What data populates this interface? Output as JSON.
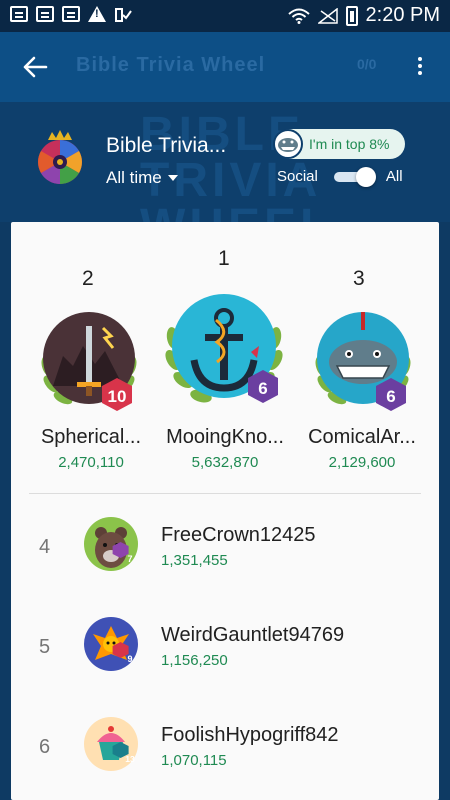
{
  "status_bar": {
    "time": "2:20 PM"
  },
  "app_bar": {
    "title": "Bible Trivia Wheel",
    "faded_label": "0/0"
  },
  "header": {
    "game_title": "Bible Trivia...",
    "watermark": "BIBLE TRIVIA WHEEL",
    "filter_label": "All time",
    "top_badge": "I'm in top 8%",
    "toggle_left": "Social",
    "toggle_right": "All"
  },
  "podium": [
    {
      "rank": "2",
      "name": "Spherical...",
      "score": "2,470,110",
      "level": "10",
      "avatar": "sword-avatar-icon"
    },
    {
      "rank": "1",
      "name": "MooingKno...",
      "score": "5,632,870",
      "level": "6",
      "avatar": "anchor-avatar-icon"
    },
    {
      "rank": "3",
      "name": "ComicalAr...",
      "score": "2,129,600",
      "level": "6",
      "avatar": "shark-avatar-icon"
    }
  ],
  "rows": [
    {
      "rank": "4",
      "name": "FreeCrown12425",
      "score": "1,351,455",
      "level": "7",
      "avatar": "bear-avatar-icon"
    },
    {
      "rank": "5",
      "name": "WeirdGauntlet94769",
      "score": "1,156,250",
      "level": "9",
      "avatar": "phoenix-avatar-icon"
    },
    {
      "rank": "6",
      "name": "FoolishHypogriff842",
      "score": "1,070,115",
      "level": "13",
      "avatar": "cupcake-avatar-icon"
    }
  ],
  "colors": {
    "score_green": "#1f8a52",
    "header_blue": "#0e3f6c",
    "appbar_blue": "#0d4f86",
    "level_red": "#d8344a",
    "level_purple": "#6b3fa0",
    "level_teal": "#1a7f8c"
  }
}
